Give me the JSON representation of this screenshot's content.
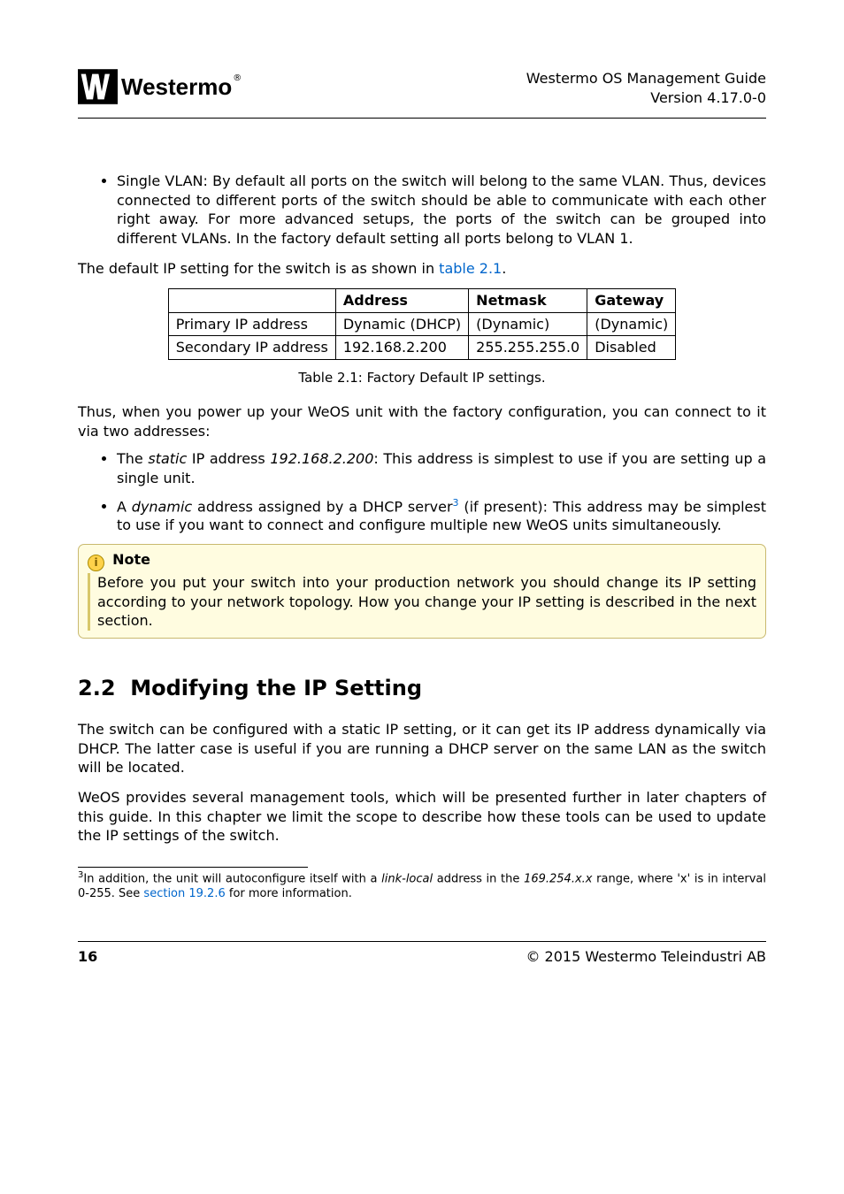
{
  "header": {
    "logo_text": "Westermo",
    "title_line1": "Westermo OS Management Guide",
    "title_line2": "Version 4.17.0-0"
  },
  "bullet_vlan": "Single VLAN: By default all ports on the switch will belong to the same VLAN. Thus, devices connected to different ports of the switch should be able to communicate with each other right away. For more advanced setups, the ports of the switch can be grouped into different VLANs. In the factory default setting all ports belong to VLAN 1.",
  "para_default_ip_pre": "The default IP setting for the switch is as shown in ",
  "para_default_ip_link": "table 2.1",
  "para_default_ip_post": ".",
  "table": {
    "headers": [
      "",
      "Address",
      "Netmask",
      "Gateway"
    ],
    "rows": [
      [
        "Primary IP address",
        "Dynamic (DHCP)",
        "(Dynamic)",
        "(Dynamic)"
      ],
      [
        "Secondary IP address",
        "192.168.2.200",
        "255.255.255.0",
        "Disabled"
      ]
    ],
    "caption": "Table 2.1: Factory Default IP settings."
  },
  "para_thus": "Thus, when you power up your WeOS unit with the factory configuration, you can connect to it via two addresses:",
  "li_static_pre": "The ",
  "li_static_word": "static",
  "li_static_mid": " IP address ",
  "li_static_ip": "192.168.2.200",
  "li_static_post": ": This address is simplest to use if you are setting up a single unit.",
  "li_dynamic_pre": "A ",
  "li_dynamic_word": "dynamic",
  "li_dynamic_mid": " address assigned by a DHCP server",
  "li_dynamic_sup": "3",
  "li_dynamic_post": " (if present): This address may be simplest to use if you want to connect and configure multiple new WeOS units simultaneously.",
  "note": {
    "title": "Note",
    "body": "Before you put your switch into your production network you should change its IP setting according to your network topology. How you change your IP setting is described in the next section."
  },
  "section": {
    "number": "2.2",
    "title": "Modifying the IP Setting"
  },
  "para_configured": "The switch can be configured with a static IP setting, or it can get its IP address dynamically via DHCP. The latter case is useful if you are running a DHCP server on the same LAN as the switch will be located.",
  "para_weos": "WeOS provides several management tools, which will be presented further in later chapters of this guide. In this chapter we limit the scope to describe how these tools can be used to update the IP settings of the switch.",
  "footnote": {
    "sup": "3",
    "pre": "In addition, the unit will autoconfigure itself with a ",
    "italic1": "link-local",
    "mid": " address in the ",
    "italic2": "169.254.x.x",
    "post1": " range, where 'x' is in interval 0-255. See ",
    "link": "section 19.2.6",
    "post2": " for more information."
  },
  "footer": {
    "page": "16",
    "copyright": "© 2015 Westermo Teleindustri AB"
  }
}
